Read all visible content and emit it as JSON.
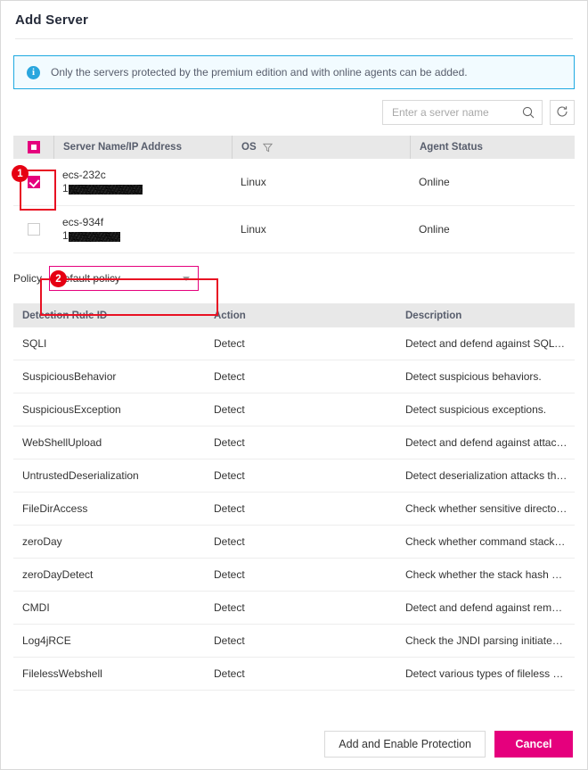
{
  "dialog": {
    "title": "Add Server"
  },
  "alert": {
    "icon": "info-icon",
    "text": "Only the servers protected by the premium edition and with online agents can be added."
  },
  "search": {
    "placeholder": "Enter a server name",
    "value": "",
    "search_icon": "search-icon",
    "refresh_icon": "refresh-icon"
  },
  "server_table": {
    "columns": [
      "Server Name/IP Address",
      "OS",
      "Agent Status"
    ],
    "select_all_state": "indeterminate",
    "os_filter_icon": "filter-funnel-icon",
    "rows": [
      {
        "selected": true,
        "name": "ecs-232c",
        "ip_prefix": "1",
        "ip_redacted": true,
        "os": "Linux",
        "agent_status": "Online"
      },
      {
        "selected": false,
        "name": "ecs-934f",
        "ip_prefix": "1",
        "ip_redacted": true,
        "os": "Linux",
        "agent_status": "Online"
      }
    ]
  },
  "policy": {
    "label": "Policy",
    "value": "default policy",
    "caret_icon": "chevron-down-icon"
  },
  "rules_table": {
    "columns": [
      "Detection Rule ID",
      "Action",
      "Description"
    ],
    "rows": [
      {
        "id": "SQLI",
        "action": "Detect",
        "description": "Detect and defend against SQL injecti..."
      },
      {
        "id": "SuspiciousBehavior",
        "action": "Detect",
        "description": "Detect suspicious behaviors."
      },
      {
        "id": "SuspiciousException",
        "action": "Detect",
        "description": "Detect suspicious exceptions."
      },
      {
        "id": "WebShellUpload",
        "action": "Detect",
        "description": "Detect and defend against attacks that..."
      },
      {
        "id": "UntrustedDeserialization",
        "action": "Detect",
        "description": "Detect deserialization attacks that expl..."
      },
      {
        "id": "FileDirAccess",
        "action": "Detect",
        "description": "Check whether sensitive directories or..."
      },
      {
        "id": "zeroDay",
        "action": "Detect",
        "description": "Check whether command stacks have..."
      },
      {
        "id": "zeroDayDetect",
        "action": "Detect",
        "description": "Check whether the stack hash of a co..."
      },
      {
        "id": "CMDI",
        "action": "Detect",
        "description": "Detect and defend against remote OS ..."
      },
      {
        "id": "Log4jRCE",
        "action": "Detect",
        "description": "Check the JNDI parsing initiated durin..."
      },
      {
        "id": "FilelessWebshell",
        "action": "Detect",
        "description": "Detect various types of fileless Java w..."
      }
    ]
  },
  "footer": {
    "confirm_label": "Add and Enable Protection",
    "cancel_label": "Cancel"
  },
  "annotations": [
    {
      "number": "1"
    },
    {
      "number": "2"
    }
  ],
  "colors": {
    "accent": "#e5007d",
    "alert_border": "#1ea9e1",
    "alert_bg": "#f2fbff",
    "annotation": "#e60012",
    "header_bg": "#e8e8e8"
  }
}
